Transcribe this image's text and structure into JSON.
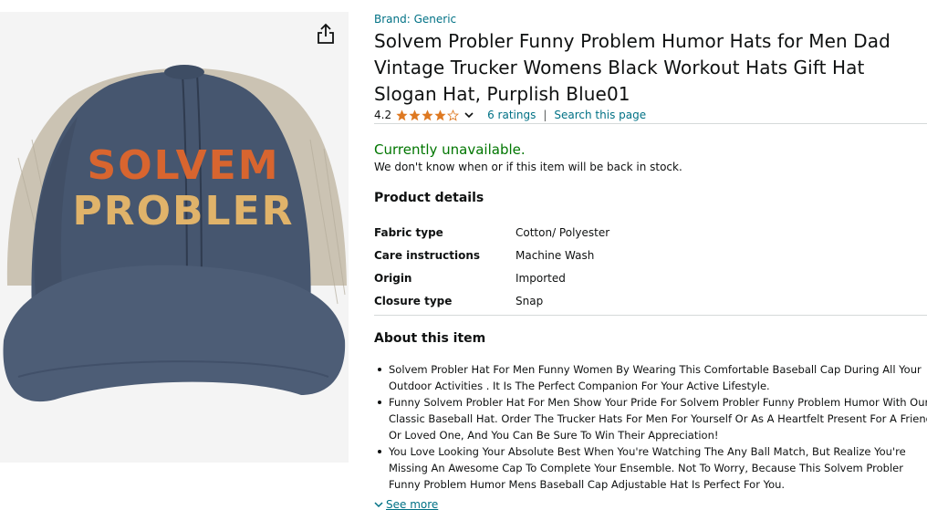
{
  "image": {
    "hat_text_line1": "SOLVEM",
    "hat_text_line2": "PROBLER",
    "colors": {
      "crown": "#46566f",
      "mesh": "#cbc3b3",
      "text_line1": "#d8652f",
      "text_line2": "#e0b36a"
    }
  },
  "product": {
    "brand": "Brand: Generic",
    "title": "Solvem Probler Funny Problem Humor Hats for Men Dad Vintage Trucker Womens Black Workout Hats Gift Hat Slogan Hat, Purplish Blue01",
    "rating_value": "4.2",
    "rating_stars": 4.2,
    "ratings_link": "6 ratings",
    "rating_separator": "|",
    "search_link": "Search this page"
  },
  "availability": {
    "status": "Currently unavailable.",
    "note": "We don't know when or if this item will be back in stock."
  },
  "product_details": {
    "heading": "Product details",
    "rows": [
      {
        "label": "Fabric type",
        "value": "Cotton/ Polyester"
      },
      {
        "label": "Care instructions",
        "value": "Machine Wash"
      },
      {
        "label": "Origin",
        "value": "Imported"
      },
      {
        "label": "Closure type",
        "value": "Snap"
      }
    ]
  },
  "about": {
    "heading": "About this item",
    "items": [
      "Solvem Probler Hat For Men Funny Women By Wearing This Comfortable Baseball Cap During All Your Outdoor Activities . It Is The Perfect Companion For Your Active Lifestyle.",
      "Funny Solvem Probler Hat For Men Show Your Pride For Solvem Probler Funny Problem Humor With Our Classic Baseball Hat. Order The Trucker Hats For Men For Yourself Or As A Heartfelt Present For A Friend Or Loved One, And You Can Be Sure To Win Their Appreciation!",
      "You Love Looking Your Absolute Best When You're Watching The Any Ball Match, But Realize You're Missing An Awesome Cap To Complete Your Ensemble. Not To Worry, Because This Solvem Probler Funny Problem Humor Mens Baseball Cap Adjustable Hat Is Perfect For You."
    ],
    "see_more": "See more"
  },
  "colors": {
    "link": "#007185",
    "available_green": "#007600",
    "star": "#de7921",
    "text": "#0f1111",
    "divider": "#d5d9d9"
  },
  "icons": {
    "share": "share-icon",
    "star": "star-icon",
    "chevron": "chevron-down-icon"
  }
}
